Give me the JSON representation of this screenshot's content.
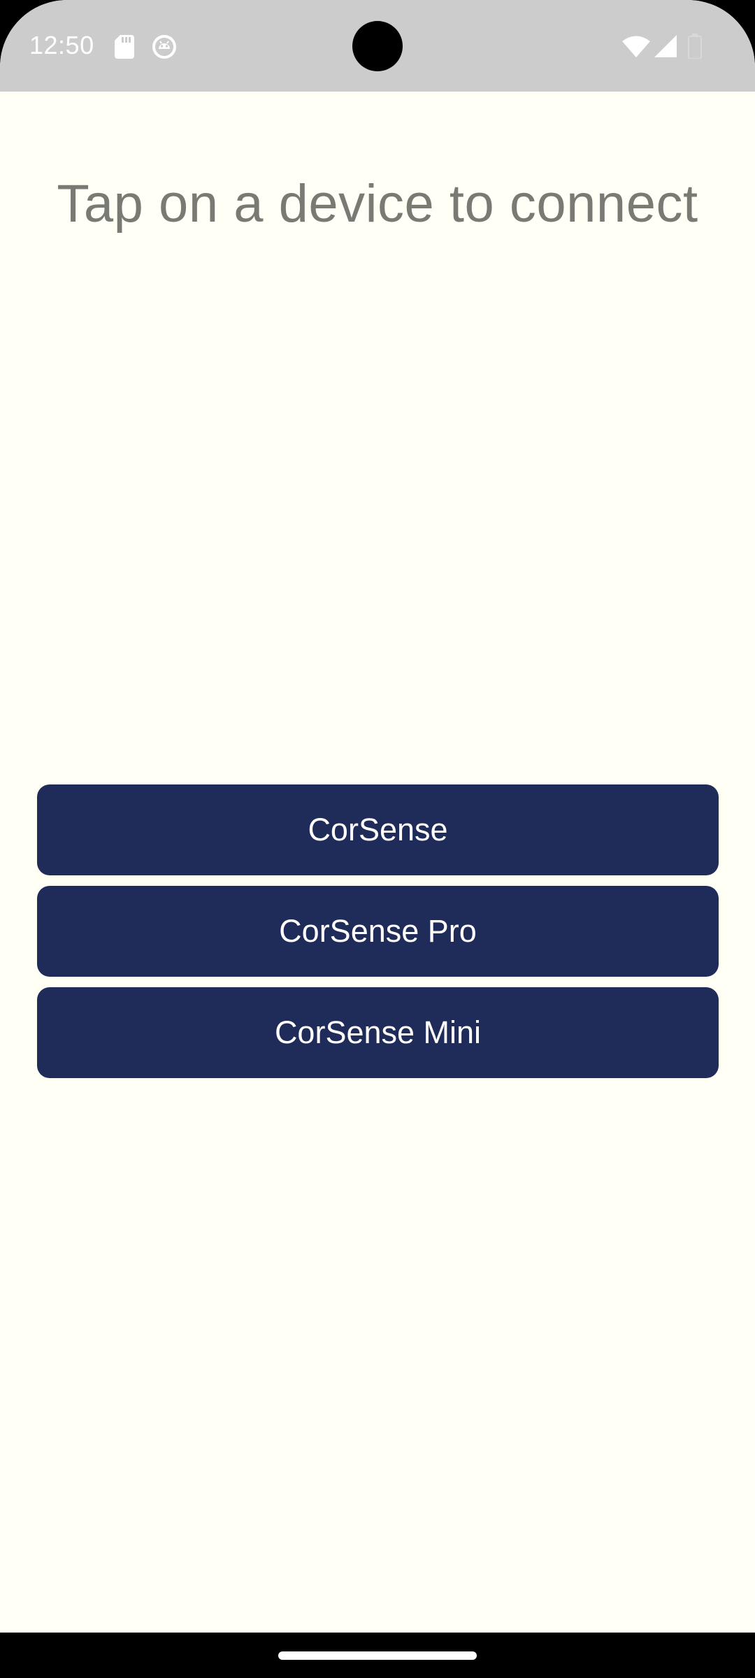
{
  "status_bar": {
    "time": "12:50",
    "left_icons": [
      "sd-card-icon",
      "android-debug-icon"
    ],
    "right_icons": [
      "wifi-icon",
      "cellular-signal-icon",
      "battery-icon"
    ]
  },
  "main": {
    "heading": "Tap on a device to connect",
    "devices": [
      {
        "label": "CorSense"
      },
      {
        "label": "CorSense Pro"
      },
      {
        "label": "CorSense Mini"
      }
    ]
  },
  "colors": {
    "background": "#fffff5",
    "status_bar": "#cccccc",
    "button": "#1f2b59",
    "heading_text": "#7a7a75"
  }
}
